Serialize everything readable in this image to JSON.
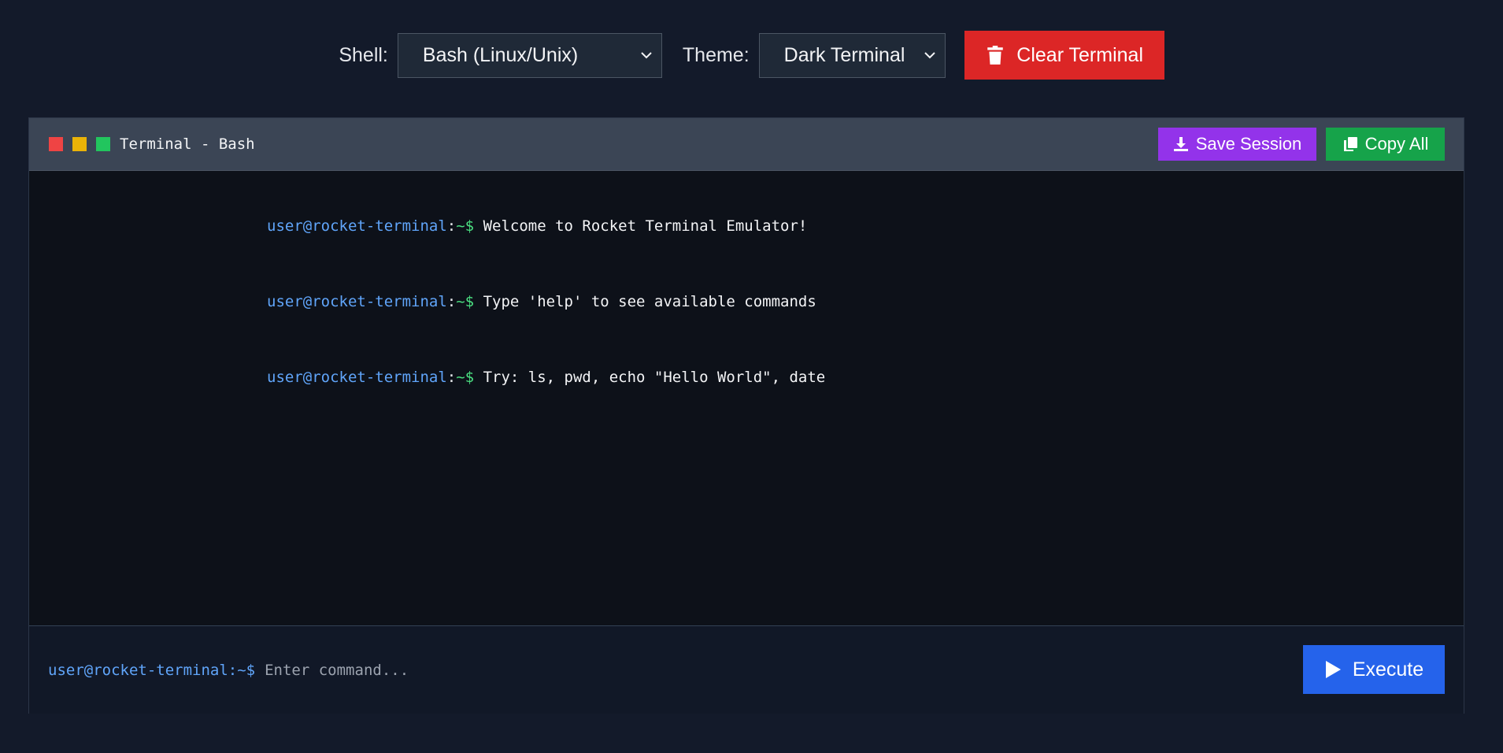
{
  "controls": {
    "shell_label": "Shell:",
    "shell_value": "Bash (Linux/Unix)",
    "theme_label": "Theme:",
    "theme_value": "Dark Terminal",
    "clear_label": "Clear Terminal"
  },
  "terminal": {
    "title": "Terminal - Bash",
    "save_label": "Save Session",
    "copy_label": "Copy All",
    "lines": [
      {
        "user": "user@rocket-terminal",
        "colon": ":",
        "path": "~$",
        "text": " Welcome to Rocket Terminal Emulator!"
      },
      {
        "user": "user@rocket-terminal",
        "colon": ":",
        "path": "~$",
        "text": " Type 'help' to see available commands"
      },
      {
        "user": "user@rocket-terminal",
        "colon": ":",
        "path": "~$",
        "text": " Try: ls, pwd, echo \"Hello World\", date"
      }
    ],
    "input_prompt": "user@rocket-terminal:~$",
    "input_placeholder": "Enter command...",
    "input_value": "",
    "execute_label": "Execute"
  },
  "colors": {
    "background": "#131a2a",
    "clear": "#dc2626",
    "save": "#9333ea",
    "copy": "#16a34a",
    "execute": "#2563eb",
    "prompt_user": "#60a5fa",
    "prompt_path": "#4ade80"
  },
  "icons": {
    "clear": "trash-icon",
    "save": "download-icon",
    "copy": "copy-icon",
    "execute": "play-icon",
    "select": "chevron-down-icon"
  }
}
